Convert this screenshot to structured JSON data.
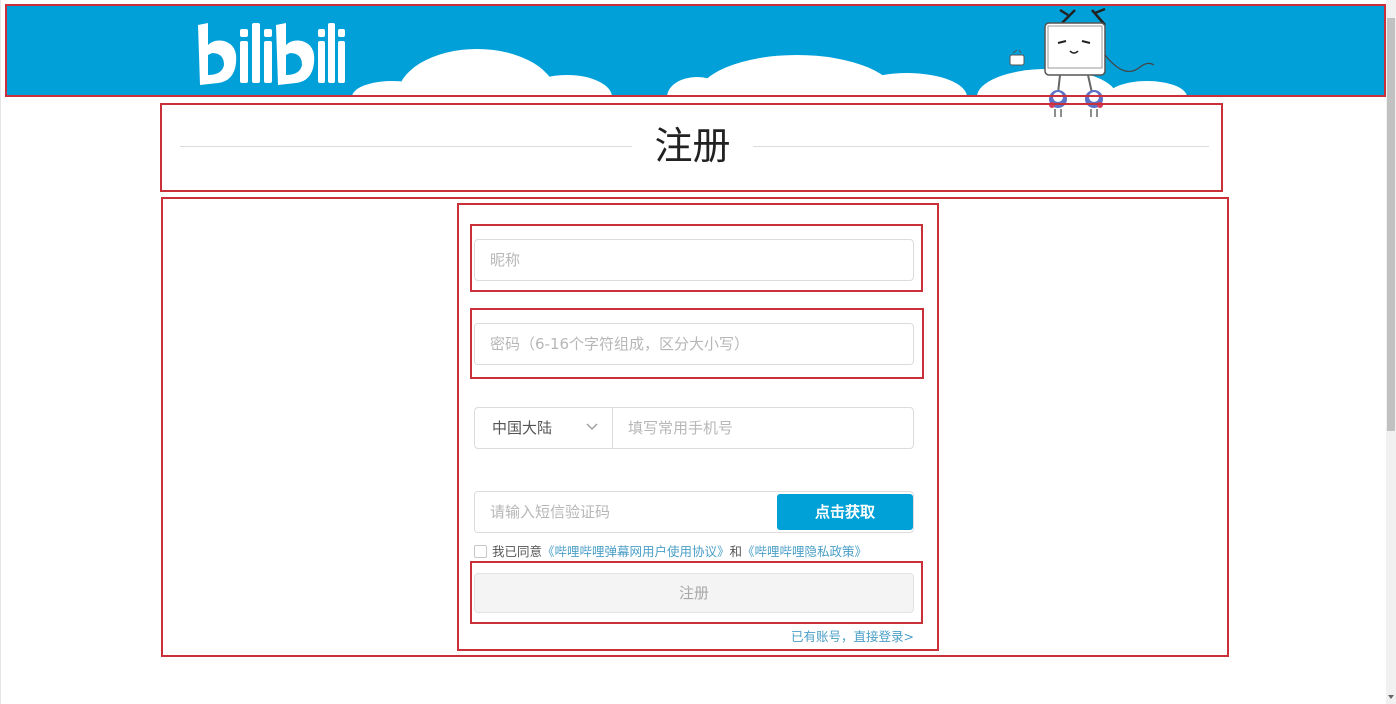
{
  "header": {
    "logo_text": "bilibili",
    "background_color": "#02a0d9"
  },
  "page_title": "注册",
  "form": {
    "nickname_placeholder": "昵称",
    "password_placeholder": "密码（6-16个字符组成，区分大小写）",
    "region_selected": "中国大陆",
    "phone_placeholder": "填写常用手机号",
    "sms_placeholder": "请输入短信验证码",
    "sms_button_label": "点击获取",
    "agreement": {
      "prefix": "我已同意",
      "user_agreement_link": "《哔哩哔哩弹幕网用户使用协议》",
      "conjunction": "和",
      "privacy_link": "《哔哩哔哩隐私政策》"
    },
    "register_button_label": "注册",
    "login_link": "已有账号，直接登录>"
  },
  "colors": {
    "accent": "#00a1d6",
    "link": "#4a9fc7",
    "annotation_box": "#c9303a"
  },
  "icons": {
    "region_dropdown": "chevron-down-icon"
  }
}
